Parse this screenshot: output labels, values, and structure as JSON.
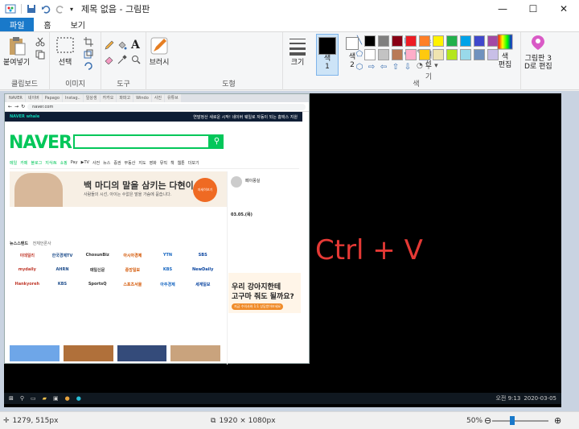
{
  "titlebar": {
    "title": "제목 없음 - 그림판",
    "minimize": "—",
    "maximize": "☐",
    "close": "✕"
  },
  "tabs": [
    "파일",
    "홈",
    "보기"
  ],
  "ribbon": {
    "clipboard": {
      "paste": "붙여넣기",
      "group": "클립보드"
    },
    "image": {
      "select": "선택",
      "group": "이미지"
    },
    "tools": {
      "group": "도구"
    },
    "brush": {
      "label": "브러시"
    },
    "shapes": {
      "outline": "윤곽선",
      "fill": "채우기",
      "group": "도형"
    },
    "size": {
      "label": "크기"
    },
    "color1": {
      "label": "색\n1"
    },
    "color2": {
      "label": "색\n2"
    },
    "palette_group": "색",
    "edit_colors": "색\n편집",
    "paint3d": "그림판 3\nD로 편집",
    "palette": [
      "#000000",
      "#7f7f7f",
      "#880015",
      "#ed1c24",
      "#ff7f27",
      "#fff200",
      "#22b14c",
      "#00a2e8",
      "#3f48cc",
      "#a349a4",
      "#ffffff",
      "#c3c3c3",
      "#b97a57",
      "#ffaec9",
      "#ffc90e",
      "#efe4b0",
      "#b5e61d",
      "#99d9ea",
      "#7092be",
      "#c8bfe7"
    ]
  },
  "screenshot": {
    "tabs": [
      "NAVER",
      "네이버",
      "Papago",
      "Instag..",
      "일상생",
      "카카오",
      "파파고",
      "Windo",
      "사진",
      "유튜브"
    ],
    "url": "naver.com",
    "whale": "NAVER whale",
    "whale_msg": "연말정산 새로운 시작! 네이버 웨일로 자동이 되는 홈택스 지원",
    "logo": "NAVER",
    "menu": [
      "메일",
      "카페",
      "블로그",
      "지식iN",
      "쇼핑",
      "Pay",
      "▶TV",
      "사전",
      "뉴스",
      "증권",
      "부동산",
      "지도",
      "영화",
      "뮤직",
      "책",
      "웹툰",
      "더보기"
    ],
    "banner_title": "백 마디의 말을 삼키는 다현이",
    "banner_sub": "사람들의 시선, 아이는 수없은 말을 가슴에 묻습니다.",
    "banner_btn": "자세히보기",
    "news_tab": "뉴스스탠드",
    "news_sub": "전체언론사",
    "brands": [
      "이데일리",
      "한국경제TV",
      "ChosunBiz",
      "아시아경제",
      "YTN",
      "SBS",
      "mydaily",
      "AHRN",
      "매일신문",
      "중앙일보",
      "KBS",
      "NewDaily",
      "Hankyoreh",
      "KBS",
      "SportsQ",
      "스포츠서울",
      "아주경제",
      "세계일보"
    ],
    "user": "페이몽실",
    "date": "03.05.(목)",
    "ad1": "우리 강아지한테",
    "ad2": "고구마 줘도 될까요?",
    "ad3": "지금 수의사와 1:1 상담받아보세요",
    "side_tab": "쇼핑"
  },
  "overlay_text": "Ctrl + V",
  "taskbar": {
    "clock": "오전 9:13",
    "date": "2020-03-05"
  },
  "status": {
    "cursor": "1279, 515px",
    "dimensions": "1920 × 1080px",
    "zoom": "50%"
  }
}
